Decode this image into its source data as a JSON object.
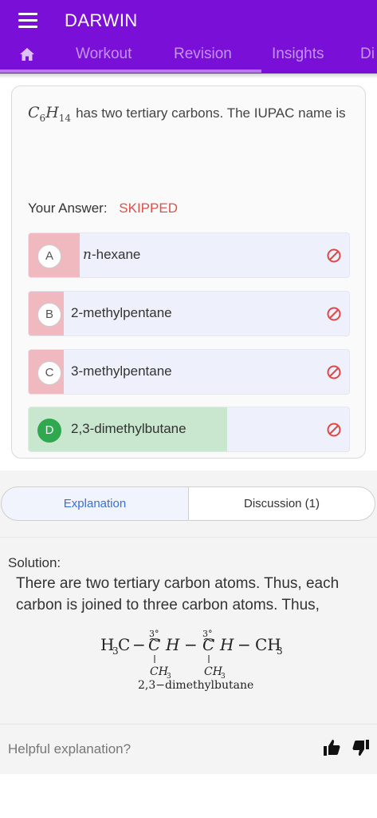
{
  "header": {
    "app_title": "DARWIN",
    "tabs": [
      "Workout",
      "Revision",
      "Insights",
      "Di"
    ],
    "bg_color": "#7a0fd8"
  },
  "question": {
    "formula_c": "C",
    "formula_c_sub": "6",
    "formula_h": "H",
    "formula_h_sub": "14",
    "text": "has two tertiary carbons. The IUPAC name is"
  },
  "answer": {
    "label": "Your Answer:",
    "value": "SKIPPED",
    "value_color": "#d9534f"
  },
  "options": [
    {
      "letter": "A",
      "italic_prefix": "n",
      "text": "-hexane",
      "state": "wrong-ban",
      "fill_color": "#f0b9bf"
    },
    {
      "letter": "B",
      "italic_prefix": "",
      "text": "2-methylpentane",
      "state": "wrong-ban",
      "fill_color": "#f0b9bf"
    },
    {
      "letter": "C",
      "italic_prefix": "",
      "text": "3-methylpentane",
      "state": "wrong-ban",
      "fill_color": "#f0b9bf"
    },
    {
      "letter": "D",
      "italic_prefix": "",
      "text": "2,3-dimethylbutane",
      "state": "correct",
      "fill_color": "#c9e6cf"
    }
  ],
  "segments": {
    "explanation": "Explanation",
    "discussion": "Discussion (1)"
  },
  "solution": {
    "heading": "Solution:",
    "body": "There are two tertiary carbon atoms. Thus, each carbon is joined to three carbon atoms. Thus,",
    "structure": {
      "left_group": "H",
      "left_group_sub": "3",
      "carbon": "C",
      "c_label": "3°",
      "hydrogen": "H",
      "right_group": "CH",
      "right_group_sub": "3",
      "dash": "−",
      "substituent": "CH",
      "substituent_sub": "3",
      "caption": "2,3−dimethylbutane"
    }
  },
  "feedback": {
    "label": "Helpful explanation?",
    "icons": [
      "thumbs-up-icon",
      "thumbs-down-icon"
    ]
  }
}
